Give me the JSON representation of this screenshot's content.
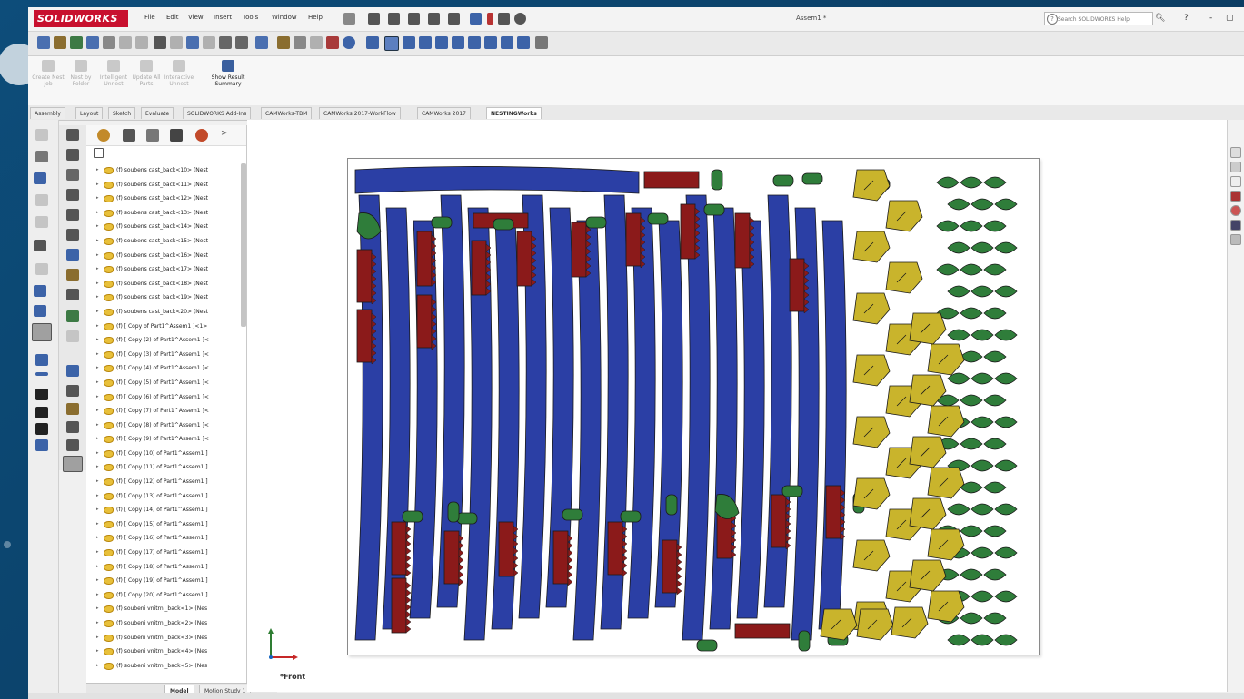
{
  "app": {
    "logo": "SOLIDWORKS",
    "document_title": "Assem1 *",
    "menus": [
      "File",
      "Edit",
      "View",
      "Insert",
      "Tools",
      "Window",
      "Help"
    ],
    "search_placeholder": "Search SOLIDWORKS Help",
    "window_controls": [
      "?",
      "-",
      "▢"
    ]
  },
  "command_manager": [
    {
      "label": "Create Nest Job",
      "enabled": false
    },
    {
      "label": "Nest by Folder",
      "enabled": false
    },
    {
      "label": "Intelligent Unnest",
      "enabled": false
    },
    {
      "label": "Update All Parts",
      "enabled": false
    },
    {
      "label": "Interactive Unnest",
      "enabled": false
    },
    {
      "label": "Show Result Summary",
      "enabled": true
    }
  ],
  "tabs": [
    "Assembly",
    "Layout",
    "Sketch",
    "Evaluate",
    "SOLIDWORKS Add-Ins",
    "CAMWorks-TBM",
    "CAMWorks 2017-WorkFlow",
    "CAMWorks 2017",
    "NESTINGWorks"
  ],
  "active_tab": "NESTINGWorks",
  "tree_items": [
    "(f) soubens cast_back<10> (Nest",
    "(f) soubens cast_back<11> (Nest",
    "(f) soubens cast_back<12> (Nest",
    "(f) soubens cast_back<13> (Nest",
    "(f) soubens cast_back<14> (Nest",
    "(f) soubens cast_back<15> (Nest",
    "(f) soubens cast_back<16> (Nest",
    "(f) soubens cast_back<17> (Nest",
    "(f) soubens cast_back<18> (Nest",
    "(f) soubens cast_back<19> (Nest",
    "(f) soubens cast_back<20> (Nest",
    "(f) [ Copy of Part1^Assem1 ]<1>",
    "(f) [ Copy (2) of Part1^Assem1 ]<",
    "(f) [ Copy (3) of Part1^Assem1 ]<",
    "(f) [ Copy (4) of Part1^Assem1 ]<",
    "(f) [ Copy (5) of Part1^Assem1 ]<",
    "(f) [ Copy (6) of Part1^Assem1 ]<",
    "(f) [ Copy (7) of Part1^Assem1 ]<",
    "(f) [ Copy (8) of Part1^Assem1 ]<",
    "(f) [ Copy (9) of Part1^Assem1 ]<",
    "(f) [ Copy (10) of Part1^Assem1 ]",
    "(f) [ Copy (11) of Part1^Assem1 ]",
    "(f) [ Copy (12) of Part1^Assem1 ]",
    "(f) [ Copy (13) of Part1^Assem1 ]",
    "(f) [ Copy (14) of Part1^Assem1 ]",
    "(f) [ Copy (15) of Part1^Assem1 ]",
    "(f) [ Copy (16) of Part1^Assem1 ]",
    "(f) [ Copy (17) of Part1^Assem1 ]",
    "(f) [ Copy (18) of Part1^Assem1 ]",
    "(f) [ Copy (19) of Part1^Assem1 ]",
    "(f) [ Copy (20) of Part1^Assem1 ]",
    "(f) soubeni vnitrni_back<1> (Nes",
    "(f) soubeni vnitrni_back<2> (Nes",
    "(f) soubeni vnitrni_back<3> (Nes",
    "(f) soubeni vnitrni_back<4> (Nes",
    "(f) soubeni vnitrni_back<5> (Nes"
  ],
  "bottom_tabs": [
    "Model",
    "Motion Study 1"
  ],
  "view_name": "*Front",
  "nest_colors": {
    "blue": "#2b3fa5",
    "red": "#8b1a1a",
    "green": "#2f7d3a",
    "yellow": "#c9b42c"
  }
}
